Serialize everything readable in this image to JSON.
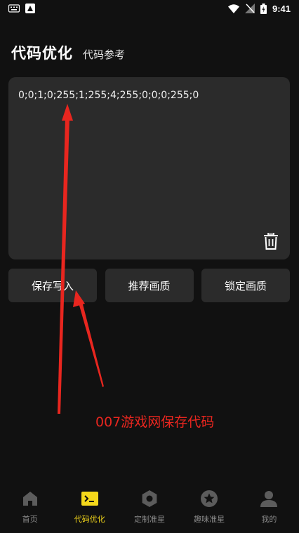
{
  "status_bar": {
    "time": "9:41",
    "icons": [
      "keyboard-icon",
      "a-app-icon",
      "wifi-icon",
      "signal-icon",
      "battery-icon"
    ]
  },
  "header": {
    "title": "代码优化",
    "subtitle": "代码参考"
  },
  "code_box": {
    "value": "0;0;1;0;255;1;255;4;255;0;0;0;255;0"
  },
  "buttons": {
    "save_write": "保存写入",
    "recommend_quality": "推荐画质",
    "lock_quality": "锁定画质"
  },
  "annotation": {
    "text": "007游戏网保存代码",
    "color": "#e8261f"
  },
  "tabbar": {
    "active_color": "#f5d81b",
    "inactive_color": "#8a8a8a",
    "items": [
      {
        "label": "首页",
        "icon": "home-icon"
      },
      {
        "label": "代码优化",
        "icon": "terminal-icon"
      },
      {
        "label": "定制准星",
        "icon": "hexagon-nut-icon"
      },
      {
        "label": "趣味准星",
        "icon": "star-circle-icon"
      },
      {
        "label": "我的",
        "icon": "person-icon"
      }
    ]
  }
}
